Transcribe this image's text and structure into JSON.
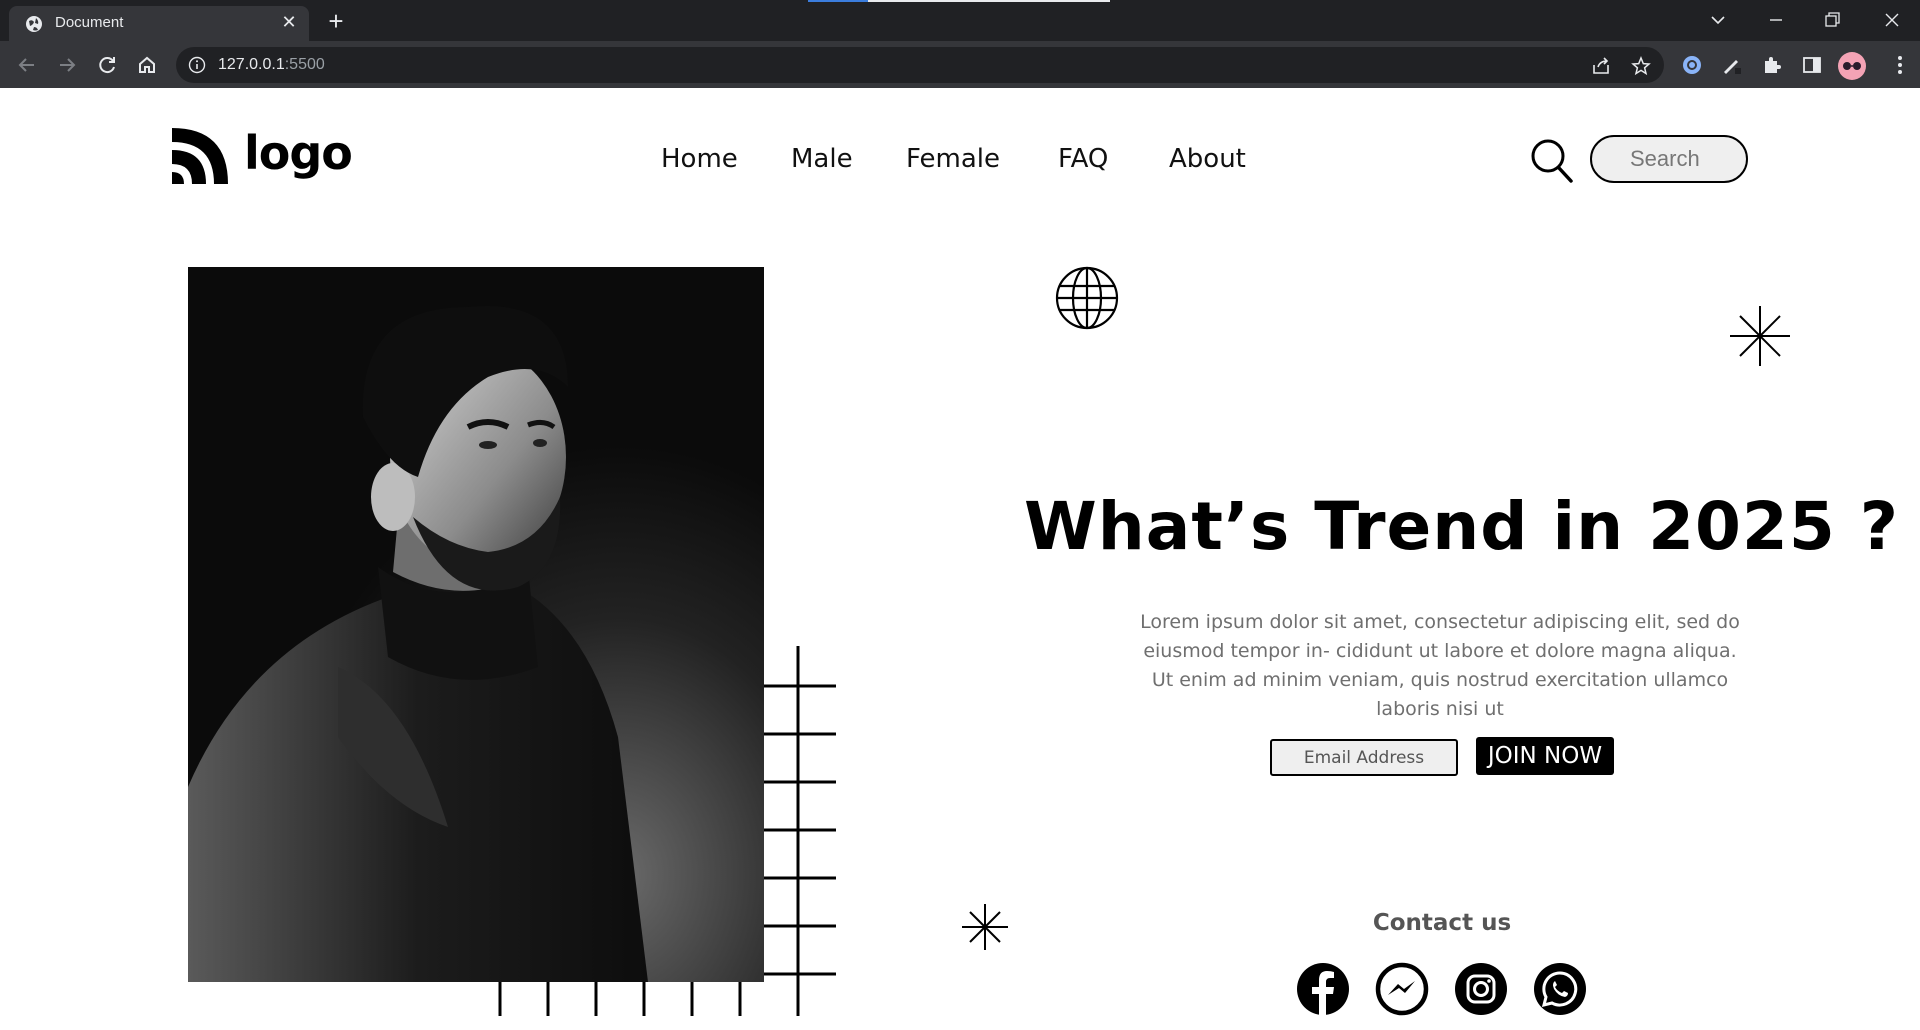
{
  "browser": {
    "tab_title": "Document",
    "tab_close": "✕",
    "new_tab": "+",
    "url_host": "127.0.0.1",
    "url_port": ":5500"
  },
  "header": {
    "logo_text": "logo",
    "nav": [
      "Home",
      "Male",
      "Female",
      "FAQ",
      "About"
    ],
    "search_placeholder": "Search"
  },
  "hero": {
    "headline": "What’s Trend in 2025 ?",
    "lead": "Lorem ipsum dolor sit amet, consectetur adipiscing elit, sed do eiusmod tempor in- cididunt ut labore et dolore magna aliqua. Ut enim ad minim veniam, quis nostrud exercitation ullamco laboris nisi ut",
    "email_placeholder": "Email Address",
    "join_label": "JOIN NOW"
  },
  "contact": {
    "title": "Contact us",
    "socials": [
      "facebook-icon",
      "messenger-icon",
      "instagram-icon",
      "whatsapp-icon"
    ]
  },
  "colors": {
    "chrome_dark": "#202124",
    "chrome_toolbar": "#35363a",
    "text_primary": "#000000",
    "text_muted": "#6f6f6f",
    "input_bg": "#efefef"
  }
}
